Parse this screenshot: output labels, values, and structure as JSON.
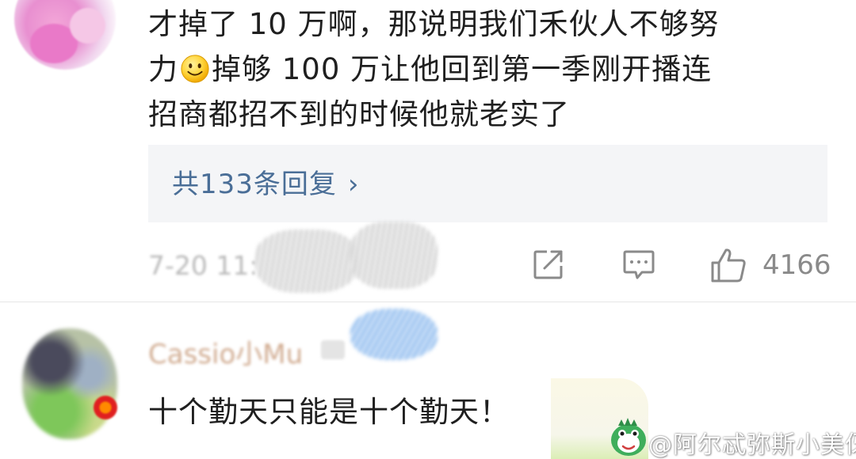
{
  "top_comment": {
    "lines": [
      "才掉了 10 万啊，那说明我们禾伙人不够努",
      "掉够 100 万让他回到第一季刚开播连",
      "招商都招不到的时候他就老实了"
    ],
    "line2_prefix": "力",
    "emoji": "smiley-emoji"
  },
  "reply_box": {
    "label": "共133条回复",
    "chevron": "›"
  },
  "meta": {
    "timestamp": "7-20 11:"
  },
  "actions": {
    "share_icon": "share-icon",
    "comment_icon": "comment-icon",
    "like_icon": "thumbs-up-icon",
    "like_count": "4166"
  },
  "second_comment": {
    "username": "Cassio小Mu",
    "text": "十个勤天只能是十个勤天！"
  },
  "watermark": {
    "text": "@阿尔忒弥斯小美伢"
  },
  "colors": {
    "link": "#4a6e97",
    "reply_bg": "#f4f5f7",
    "meta_gray": "#8a8a8a",
    "divider": "#e6e6e6"
  }
}
